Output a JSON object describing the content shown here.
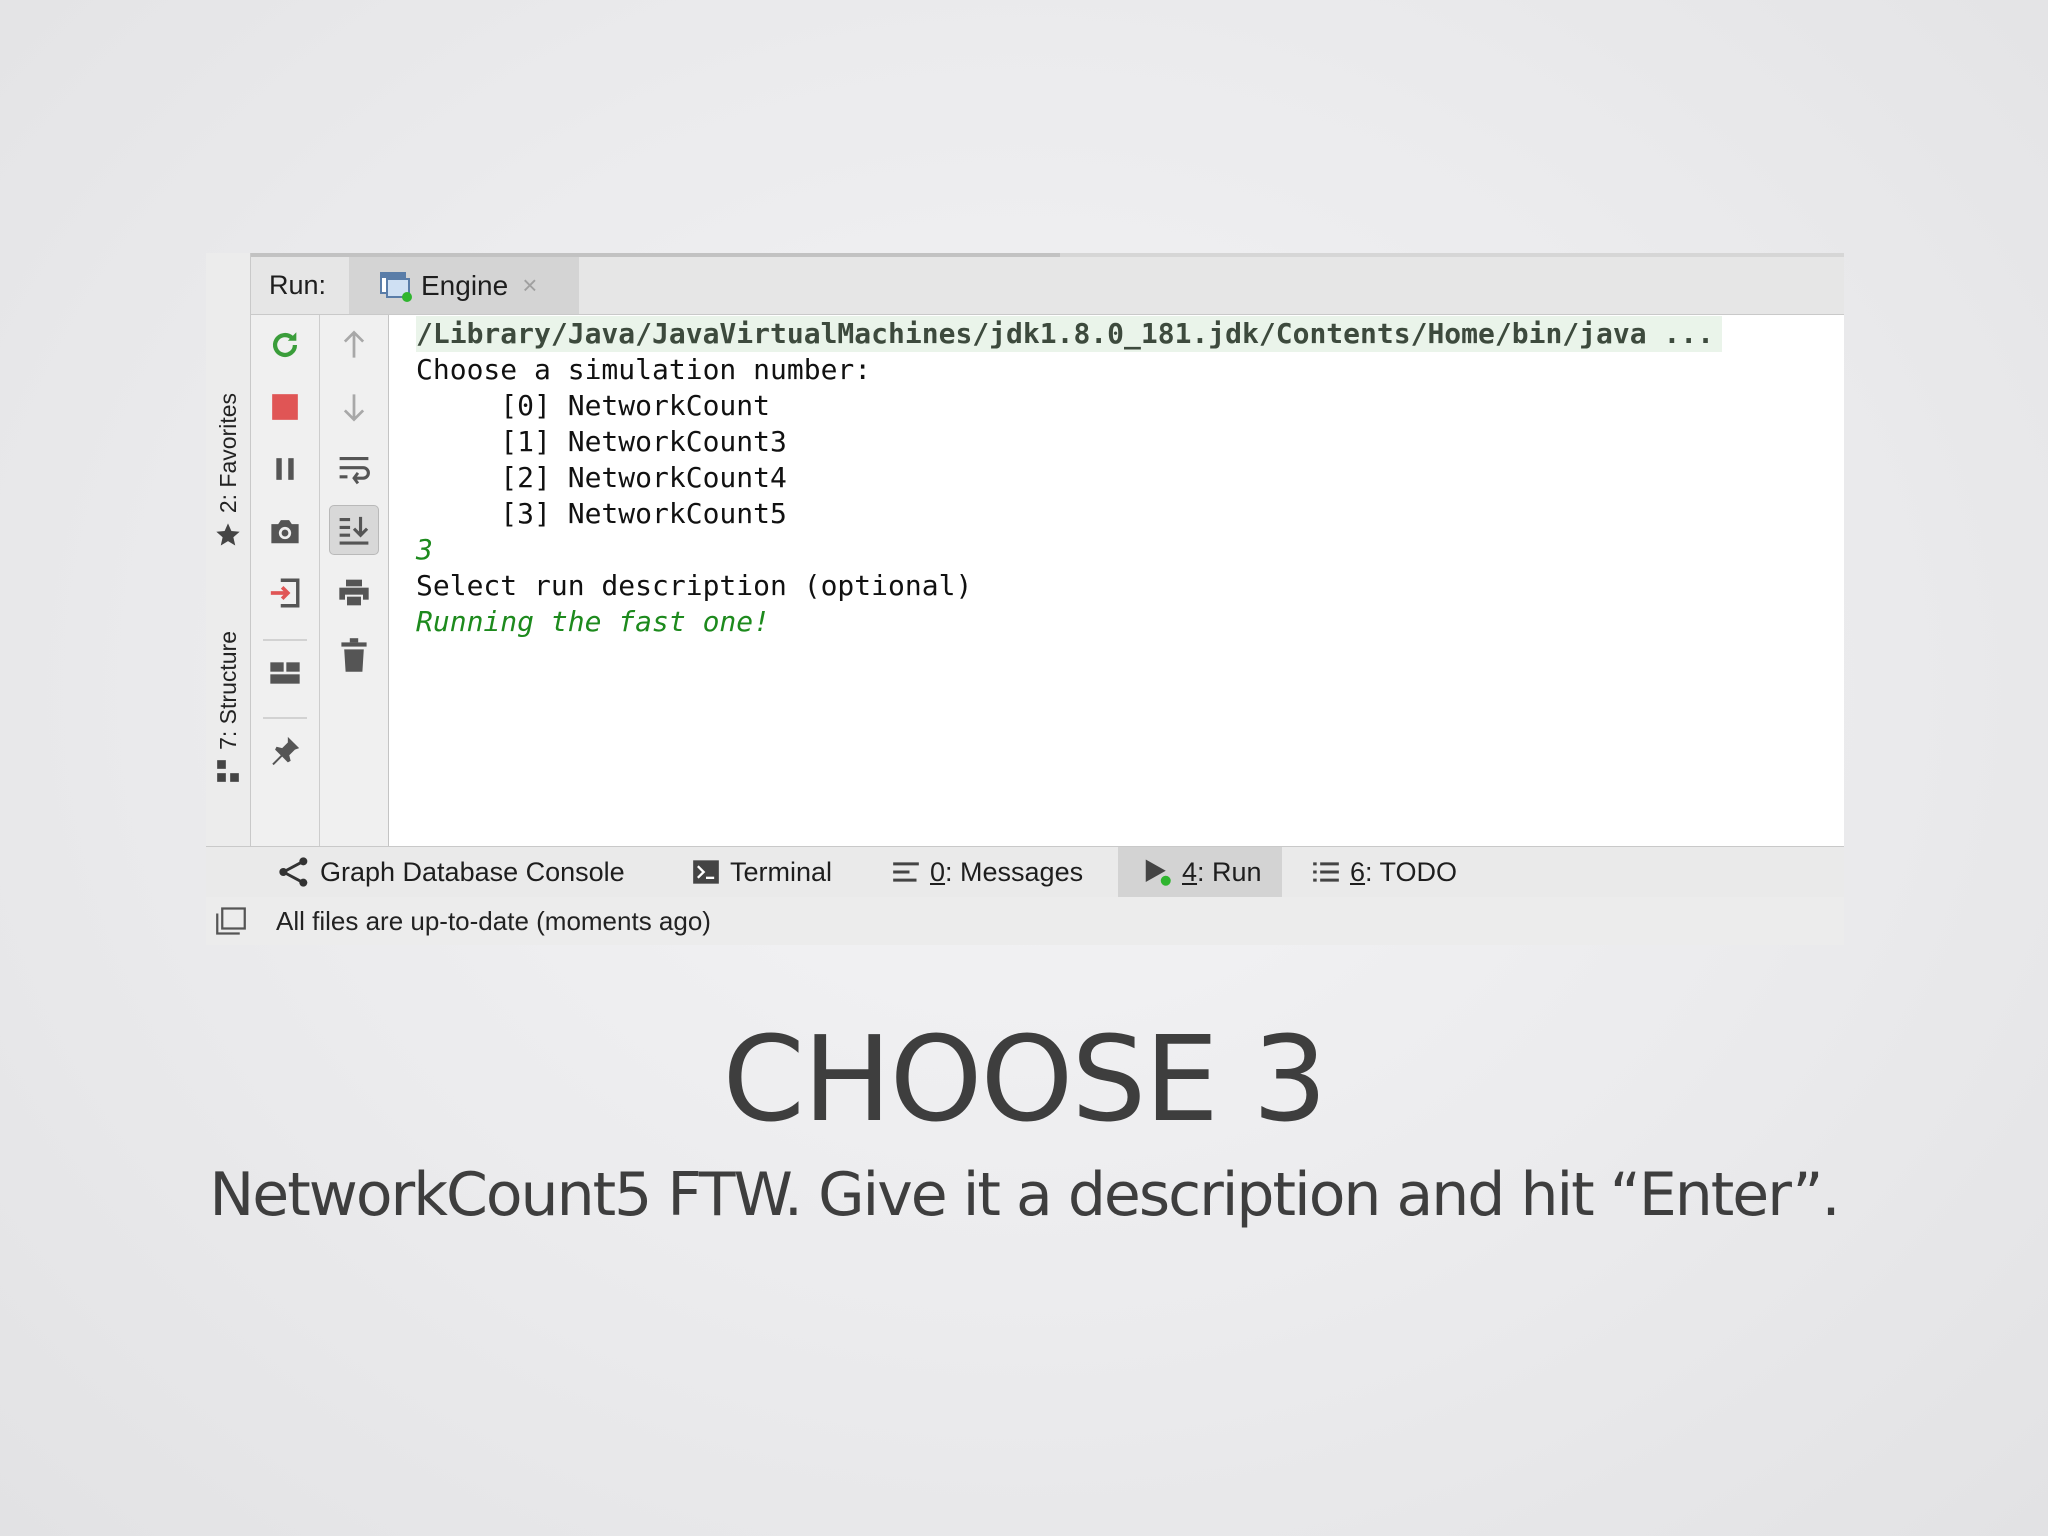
{
  "run_panel": {
    "run_label": "Run:",
    "tab": {
      "label": "Engine",
      "close": "×"
    }
  },
  "side_tabs": [
    {
      "label": "2: Favorites",
      "icon": "star-icon"
    },
    {
      "label": "7: Structure",
      "icon": "structure-icon"
    }
  ],
  "toolbar_left": [
    "rerun-icon",
    "stop-icon",
    "pause-icon",
    "camera-icon",
    "exit-icon",
    "layout-icon",
    "pin-icon"
  ],
  "toolbar_right": [
    "arrow-up-icon",
    "arrow-down-icon",
    "soft-wrap-icon",
    "scroll-to-end-icon",
    "print-icon",
    "trash-icon"
  ],
  "console": {
    "command": "/Library/Java/JavaVirtualMachines/jdk1.8.0_181.jdk/Contents/Home/bin/java ...",
    "prompt": "Choose a simulation number:",
    "options": [
      "     [0] NetworkCount",
      "     [1] NetworkCount3",
      "     [2] NetworkCount4",
      "     [3] NetworkCount5"
    ],
    "user_input": "3",
    "description_prompt": "Select run description (optional)",
    "user_description": "Running the fast one!"
  },
  "bottom_tabs": {
    "graph": {
      "label": "Graph Database Console"
    },
    "terminal": {
      "label": "Terminal"
    },
    "messages": {
      "num": "0",
      "rest": ": Messages"
    },
    "run": {
      "num": "4",
      "rest": ": Run"
    },
    "todo": {
      "num": "6",
      "rest": ": TODO"
    }
  },
  "status": {
    "text": "All files are up-to-date (moments ago)"
  },
  "slide": {
    "title": "CHOOSE 3",
    "subtitle": "NetworkCount5 FTW. Give it a description and hit “Enter”."
  },
  "colors": {
    "stop_red": "#e05555",
    "rerun_green": "#3a9d3a",
    "console_green": "#1d8a1d",
    "slide_text": "#3e3e3e"
  }
}
